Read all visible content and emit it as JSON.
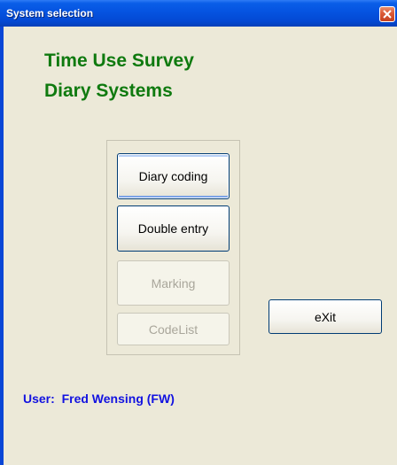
{
  "window": {
    "title": "System selection",
    "close_icon": "close-icon"
  },
  "app": {
    "title_line1": "Time Use Survey",
    "title_line2": "Diary Systems"
  },
  "buttons": {
    "diary_coding": "Diary coding",
    "double_entry": "Double entry",
    "marking": "Marking",
    "codelist": "CodeList",
    "exit": "eXit"
  },
  "status": {
    "user": "User:  Fred Wensing (FW)"
  },
  "colors": {
    "title_green": "#0f7a0f",
    "user_blue": "#1212e0",
    "titlebar_blue": "#0553e0",
    "client_bg": "#ece9d8"
  }
}
